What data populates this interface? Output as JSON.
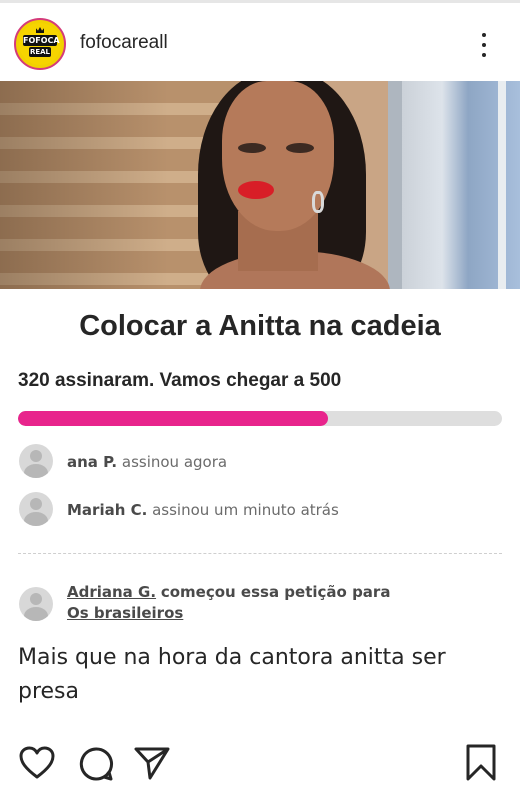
{
  "header": {
    "logo": {
      "line1": "FOFOCA",
      "line2": "REAL"
    },
    "username": "fofocareall",
    "more_icon": "more-vertical-icon"
  },
  "petition": {
    "title": "Colocar a Anitta na cadeia",
    "signed_text": "320 assinaram. Vamos chegar a  500",
    "signed": 320,
    "goal": 500,
    "progress_color": "#e8248c",
    "track_color": "#dedede",
    "signers": [
      {
        "name": "ana P.",
        "action": "assinou agora"
      },
      {
        "name": "Mariah C.",
        "action": "assinou um minuto atrás"
      }
    ],
    "starter": {
      "name": "Adriana G.",
      "action": "começou essa petição para",
      "target": "Os brasileiros"
    },
    "description": "Mais que na hora da cantora anitta ser presa"
  },
  "actions": {
    "like_icon": "heart-icon",
    "comment_icon": "comment-icon",
    "share_icon": "send-icon",
    "save_icon": "bookmark-icon"
  }
}
